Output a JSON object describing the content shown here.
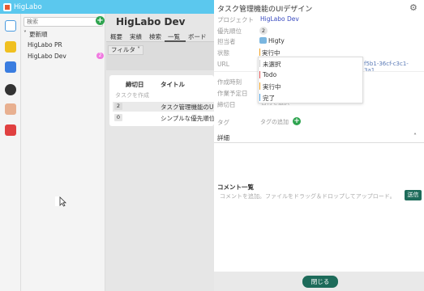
{
  "app": {
    "title": "HigLabo",
    "brand_color": "#5bc8ee"
  },
  "sidebar": {
    "search_placeholder": "検索",
    "group_label": "更新順",
    "projects": [
      {
        "name": "HigLabo PR"
      },
      {
        "name": "HigLabo Dev",
        "badge": "2"
      }
    ]
  },
  "main": {
    "project_title": "HigLabo Dev",
    "tabs": [
      "概要",
      "実績",
      "検索",
      "一覧",
      "ボード"
    ],
    "filter_label": "フィルタ",
    "columns": [
      "締切日",
      "タイトル"
    ],
    "create_placeholder": "タスクを作成",
    "rows": [
      {
        "priority": "2",
        "title": "タスク管理機能のUIデ"
      },
      {
        "priority": "0",
        "title": "シンプルな優先順位ス"
      }
    ]
  },
  "panel": {
    "title": "タスク管理機能のUIデザイン",
    "labels": {
      "project": "プロジェクト",
      "priority": "優先順位",
      "assignee": "担当者",
      "status": "状態",
      "url": "URL",
      "created": "作成時刻",
      "planned": "作業予定日",
      "deadline": "締切日",
      "tags": "タグ",
      "details": "詳細",
      "comments": "コメント一覧"
    },
    "values": {
      "project": "HigLabo Dev",
      "priority": "2",
      "assignee": "Higty",
      "status": "実行中",
      "url": "f5b1-36cf-c3c1-3a1…",
      "deadline_placeholder": "日付を選択",
      "tag_add": "タグの追加"
    },
    "status_options": [
      {
        "label": "未選択",
        "color": "#cccccc"
      },
      {
        "label": "Todo",
        "color": "#e05050"
      },
      {
        "label": "実行中",
        "color": "#f0a020"
      },
      {
        "label": "完了",
        "color": "#4aa0e0"
      }
    ],
    "comment_placeholder": "コメントを追加。ファイルをドラッグ＆ドロップしてアップロード。",
    "send_label": "送信",
    "close_label": "閉じる",
    "accent_color": "#1d6b5a"
  }
}
